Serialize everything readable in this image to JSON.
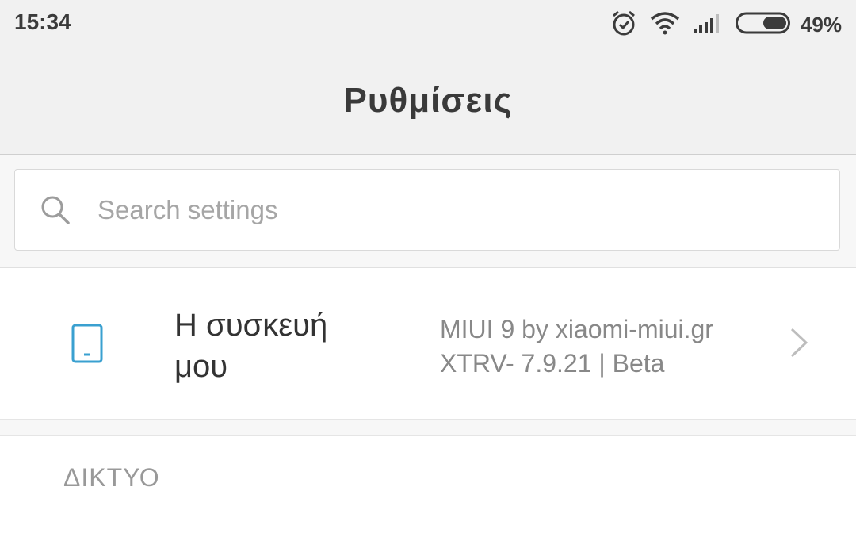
{
  "status_bar": {
    "time": "15:34",
    "battery_percent": "49%",
    "icons": [
      "alarm-icon",
      "wifi-icon",
      "signal-icon",
      "battery-icon"
    ]
  },
  "header": {
    "title": "Ρυθμίσεις"
  },
  "search": {
    "placeholder": "Search settings"
  },
  "device": {
    "label": "Η συσκευή μου",
    "info_line1": "MIUI 9 by xiaomi-miui.gr",
    "info_line2": "XTRV- 7.9.21 | Beta"
  },
  "sections": [
    {
      "header": "ΔΙΚΤΥΟ"
    }
  ],
  "colors": {
    "accent": "#3aa0d0",
    "background": "#f7f7f7"
  }
}
